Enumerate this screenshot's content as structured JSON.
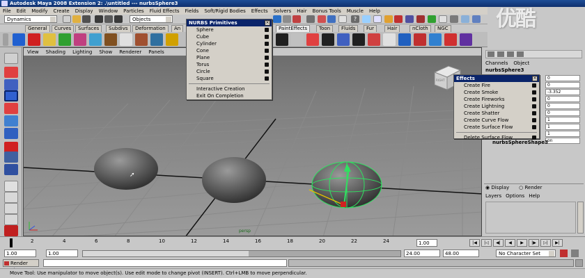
{
  "titlebar": {
    "text": "Autodesk Maya 2008 Extension 2: .\\untitled   ---   nurbsSphere3"
  },
  "watermark": "优酷",
  "menubar": [
    "File",
    "Edit",
    "Modify",
    "Create",
    "Display",
    "Window",
    "Particles",
    "Fluid Effects",
    "Fields",
    "Soft/Rigid Bodies",
    "Effects",
    "Solvers",
    "Hair",
    "Bonus Tools",
    "Muscle",
    "Help"
  ],
  "statusline": {
    "menuset": "Dynamics",
    "selection_mode": "Objects"
  },
  "shelf_tabs": [
    "General",
    "Curves",
    "Surfaces",
    "Subdivs",
    "Deformation",
    "An",
    "PaintEffects",
    "Toon",
    "Fluids",
    "Fur",
    "Hair",
    "nCloth",
    "NGC"
  ],
  "viewport": {
    "menu": [
      "View",
      "Shading",
      "Lighting",
      "Show",
      "Renderer",
      "Panels"
    ],
    "camera_label": "persp",
    "viewcube_label": "RIGHT"
  },
  "nurbs_menu": {
    "title": "NURBS Primitives",
    "items": [
      "Sphere",
      "Cube",
      "Cylinder",
      "Cone",
      "Plane",
      "Torus",
      "Circle",
      "Square"
    ],
    "extra": [
      "Interactive Creation",
      "Exit On Completion"
    ]
  },
  "effects_menu": {
    "title": "Effects",
    "items": [
      "Create Fire",
      "Create Smoke",
      "Create Fireworks",
      "Create Lightning",
      "Create Shatter",
      "Create Curve Flow",
      "Create Surface Flow"
    ],
    "extra": [
      "Delete Surface Flow"
    ]
  },
  "channelbox": {
    "tabs": [
      "Channels",
      "Object"
    ],
    "object_name": "nurbsSphere3",
    "values": [
      "0",
      "0",
      "-3.352",
      "0",
      "0",
      "0",
      "1",
      "1",
      "1",
      "on"
    ],
    "shape_name": "nurbsSphereShape3"
  },
  "layer_editor": {
    "mode_display": "Display",
    "mode_render": "Render",
    "menu": [
      "Layers",
      "Options",
      "Help"
    ]
  },
  "timeline": {
    "ticks": [
      "2",
      "4",
      "6",
      "8",
      "10",
      "12",
      "14",
      "16",
      "18",
      "20",
      "22",
      "24"
    ],
    "current_frame": "1.00"
  },
  "range": {
    "start": "1.00",
    "playback_start": "1.00",
    "playback_end": "24.00",
    "end": "48.00",
    "character_set": "No Character Set"
  },
  "commandline": {
    "label": "Render View"
  },
  "helpline": "Move Tool: Use manipulator to move object(s). Use edit mode to change pivot (INSERT).  Ctrl+LMB to move perpendicular."
}
